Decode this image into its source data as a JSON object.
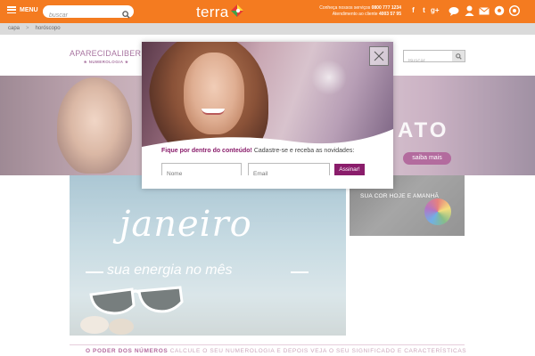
{
  "topbar": {
    "menu_label": "MENU",
    "search_placeholder": "buscar",
    "logo_text": "terra",
    "contact_line1_text": "Conheça nossos serviços",
    "contact_line1_phone": "0800 777 1234",
    "contact_line2_text": "Atendimento ao cliente",
    "contact_line2_phone": "4003 57 95",
    "social": [
      "f",
      "t",
      "g+"
    ],
    "utility_icons": [
      "chat-icon",
      "user-icon",
      "mail-icon",
      "soccer-ball-icon",
      "gear-icon"
    ],
    "color": "#f47b20"
  },
  "breadcrumb": {
    "items": [
      "capa",
      "horóscopo"
    ],
    "separator": ">"
  },
  "page": {
    "brand_name": "APARECIDALIBER",
    "brand_sub": "★ NUMEROLOGIA ★",
    "search_placeholder": "Buscar",
    "hero_text": "ATO",
    "hero_button": "saiba mais",
    "promo_title": "janeiro",
    "promo_sub": "sua energia no mês",
    "side_card_text": "SUA COR HOJE E AMANHÃ",
    "bottom_highlight": "O PODER DOS NÚMEROS",
    "bottom_text": "CALCULE O SEU NUMEROLOGIA E DEPOIS VEJA O SEU SIGNIFICADO E CARACTERÍSTICAS"
  },
  "modal": {
    "message_highlight1": "Fique por",
    "message_highlight2": "dentro do conteúdo!",
    "message_rest": " Cadastre-se e receba as novidades:",
    "name_placeholder": "Nome",
    "email_placeholder": "Email",
    "submit_label": "Assinar!",
    "accent": "#8a1d6b"
  }
}
